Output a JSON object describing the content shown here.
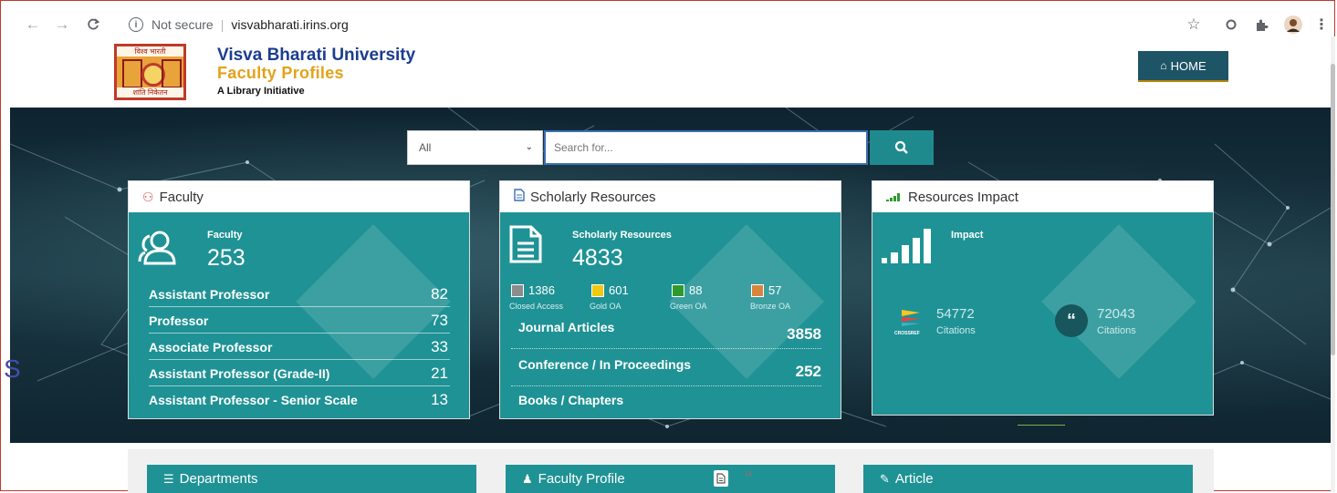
{
  "browser": {
    "security_label": "Not secure",
    "url": "visvabharati.irins.org",
    "icons": [
      "back-arrow-icon",
      "forward-arrow-icon",
      "reload-icon",
      "info-icon",
      "star-icon",
      "extension-icon",
      "puzzle-icon",
      "profile-avatar",
      "kebab-menu-icon"
    ]
  },
  "header": {
    "logo_top": "विश्व भारती",
    "logo_bottom": "शांति निकेतन",
    "title": "Visva Bharati University",
    "subtitle": "Faculty Profiles",
    "tagline": "A Library Initiative",
    "home_label": "HOME"
  },
  "search": {
    "select_value": "All",
    "placeholder": "Search for..."
  },
  "faculty_card": {
    "heading": "Faculty",
    "label": "Faculty",
    "count": "253",
    "rows": [
      {
        "label": "Assistant Professor",
        "value": "82"
      },
      {
        "label": "Professor",
        "value": "73"
      },
      {
        "label": "Associate Professor",
        "value": "33"
      },
      {
        "label": "Assistant Professor (Grade-II)",
        "value": "21"
      },
      {
        "label": "Assistant Professor - Senior Scale",
        "value": "13"
      }
    ]
  },
  "scholarly_card": {
    "heading": "Scholarly Resources",
    "label": "Scholarly Resources",
    "count": "4833",
    "oa": [
      {
        "value": "1386",
        "label": "Closed Access",
        "color": "#8c8c8c"
      },
      {
        "value": "601",
        "label": "Gold OA",
        "color": "#f2c811"
      },
      {
        "value": "88",
        "label": "Green OA",
        "color": "#2e9a2e"
      },
      {
        "value": "57",
        "label": "Bronze OA",
        "color": "#d9843c"
      }
    ],
    "rows": [
      {
        "label": "Journal Articles",
        "value": "3858"
      },
      {
        "label": "Conference / In Proceedings",
        "value": "252"
      },
      {
        "label": "Books / Chapters",
        "value": ""
      }
    ]
  },
  "impact_card": {
    "heading": "Resources Impact",
    "label": "Impact",
    "crossref": {
      "value": "54772",
      "label": "Citations",
      "logo_text": "CROSSREF"
    },
    "other": {
      "value": "72043",
      "label": "Citations"
    }
  },
  "stray_text": "S",
  "bottom": {
    "departments": "Departments",
    "faculty_profile": "Faculty Profile",
    "article": "Article"
  },
  "colors": {
    "teal": "#1f9295",
    "navy_title": "#1b3d8f",
    "gold": "#e3a21a",
    "home_bg": "#1e5566"
  }
}
